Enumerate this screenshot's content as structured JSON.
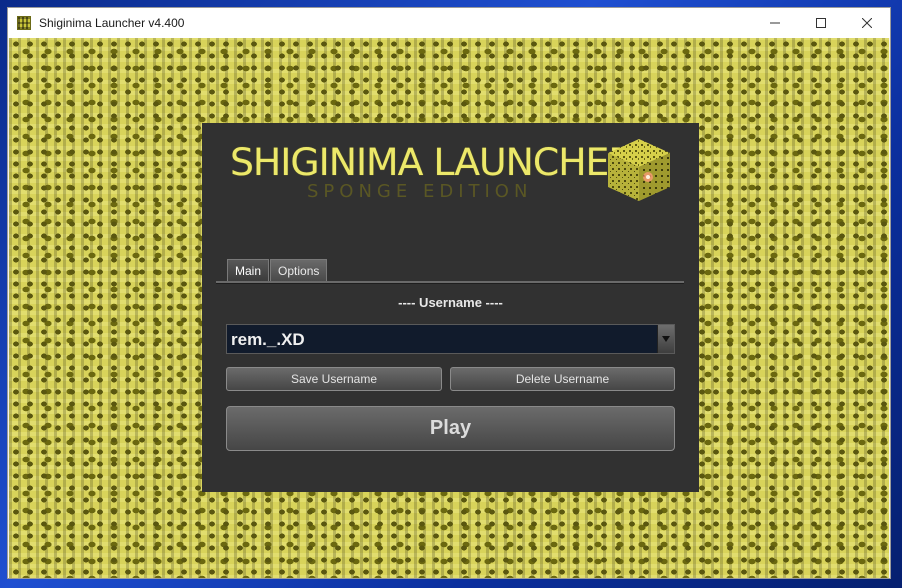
{
  "window": {
    "title": "Shiginima Launcher v4.400",
    "app_icon": "sponge-block-icon",
    "controls": {
      "minimize": "—",
      "maximize": "☐",
      "close": "✕"
    }
  },
  "logo": {
    "title": "SHIGINIMA LAUNCHER",
    "subtitle": "SPONGE EDITION",
    "icon": "sponge-cube-icon"
  },
  "tabs": [
    {
      "label": "Main",
      "active": true
    },
    {
      "label": "Options",
      "active": false
    }
  ],
  "main": {
    "username_heading": "---- Username ----",
    "username_value": "rem._.XD",
    "save_button": "Save Username",
    "delete_button": "Delete Username",
    "play_button": "Play"
  },
  "colors": {
    "panel_bg": "#313131",
    "logo_yellow": "#ece86a",
    "sponge_yellow": "#d8d35a",
    "combo_bg": "#111b2c"
  }
}
